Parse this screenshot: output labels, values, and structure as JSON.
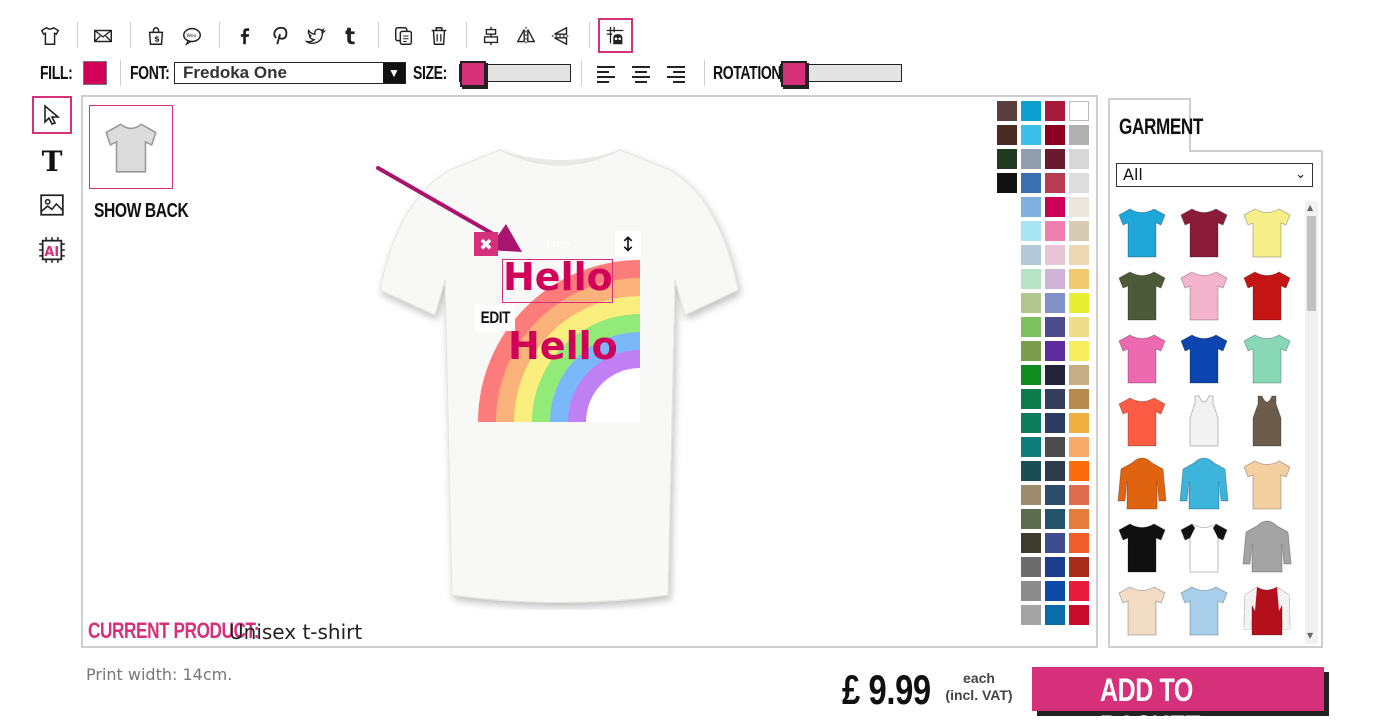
{
  "toolbar": {
    "fill_label": "FILL:",
    "fill_color": "#d10059",
    "font_label": "FONT:",
    "font_value": "Fredoka One",
    "size_label": "SIZE:",
    "rotation_label": "ROTATION:",
    "icons": [
      "tshirt-icon",
      "mail-icon",
      "shop-icon",
      "speech-icon",
      "facebook-icon",
      "pinterest-icon",
      "twitter-icon",
      "tumblr-icon",
      "copy-icon",
      "trash-icon",
      "align-center-vertical-icon",
      "flip-horizontal-icon",
      "flip-vertical-icon",
      "grid-snap-icon"
    ]
  },
  "left_tools": [
    "pointer-icon",
    "text-icon",
    "image-icon",
    "ai-icon"
  ],
  "canvas": {
    "show_back_label": "SHOW BACK",
    "text_top": "Hello",
    "text_bottom": "Hello",
    "measure_label": "14cm",
    "edit_label": "EDIT",
    "current_product_key": "CURRENT PRODUCT:",
    "current_product_value": "Unisex t-shirt",
    "print_width": "Print width: 14cm."
  },
  "palette": [
    [
      "#5a3e3e",
      "#0aa0d0",
      "#a81a3c",
      "#ffffff"
    ],
    [
      "#4b2c25",
      "#3cc0ea",
      "#8c0022",
      "#b0b0b0"
    ],
    [
      "#1f3a1f",
      "#8f9faf",
      "#6a1a2e",
      "#d8d8d8"
    ],
    [
      "#111111",
      "#3a6fb0",
      "#b83c50",
      "#dddddd"
    ],
    [
      null,
      "#7fb0e0",
      "#cc0055",
      "#ece6dc"
    ],
    [
      null,
      "#a8e4f4",
      "#ee80b0",
      "#d8cab0"
    ],
    [
      null,
      "#b4c8dc",
      "#e8c4d4",
      "#eed8b4"
    ],
    [
      null,
      "#b4e4c4",
      "#d0b4d8",
      "#f2c870"
    ],
    [
      null,
      "#b0c890",
      "#8090c8",
      "#e8ee30"
    ],
    [
      null,
      "#7cc060",
      "#4c4c8c",
      "#eede8c"
    ],
    [
      null,
      "#7c9c50",
      "#5c2c9c",
      "#f8ec5c"
    ],
    [
      null,
      "#108c20",
      "#23233a",
      "#c8ac84"
    ],
    [
      null,
      "#0c7c4c",
      "#363e5e",
      "#b8884c"
    ],
    [
      null,
      "#0c7c5c",
      "#2c3c60",
      "#f0b040"
    ],
    [
      null,
      "#0c7c7c",
      "#4c4c4c",
      "#f8ac6c"
    ],
    [
      null,
      "#1c4c54",
      "#2c3c4c",
      "#fc6c0c"
    ],
    [
      null,
      "#9c8c6c",
      "#2c4c6c",
      "#e06c50"
    ],
    [
      null,
      "#5c6c4c",
      "#24546c",
      "#e47c3c"
    ],
    [
      null,
      "#3c3c2c",
      "#3c4c8c",
      "#f05c2c"
    ],
    [
      null,
      "#6c6c6c",
      "#1c3c8c",
      "#a82c1c"
    ],
    [
      null,
      "#8c8c8c",
      "#0c4ca8",
      "#e81c3c"
    ],
    [
      null,
      "#a4a4a4",
      "#0c6ca8",
      "#c80c2c"
    ]
  ],
  "garment": {
    "tab_label": "GARMENT",
    "filter_value": "All",
    "items": [
      {
        "name": "tshirt",
        "color": "#1ea6d8"
      },
      {
        "name": "tshirt",
        "color": "#8a1c3a"
      },
      {
        "name": "tshirt",
        "color": "#f7f08a"
      },
      {
        "name": "tshirt",
        "color": "#4c5a38"
      },
      {
        "name": "tshirt",
        "color": "#f4b4cc"
      },
      {
        "name": "tshirt",
        "color": "#c41414"
      },
      {
        "name": "tshirt",
        "color": "#ee6ab0"
      },
      {
        "name": "tshirt",
        "color": "#0c44b0"
      },
      {
        "name": "tshirt",
        "color": "#88d8b8"
      },
      {
        "name": "tshirt",
        "color": "#fc5c44"
      },
      {
        "name": "vest",
        "color": "#f2f2f2"
      },
      {
        "name": "vest",
        "color": "#6c5c4c"
      },
      {
        "name": "hoodie",
        "color": "#e06410"
      },
      {
        "name": "hoodie",
        "color": "#3cb4dc"
      },
      {
        "name": "tshirt",
        "color": "#f4d0a0"
      },
      {
        "name": "tshirt",
        "color": "#101010"
      },
      {
        "name": "raglan",
        "color": "#ffffff"
      },
      {
        "name": "hoodie",
        "color": "#a4a4a4"
      },
      {
        "name": "tshirt",
        "color": "#f2dcc4"
      },
      {
        "name": "tshirt",
        "color": "#a8d0ec"
      },
      {
        "name": "jacket",
        "color": "#b4101c"
      }
    ]
  },
  "purchase": {
    "price": "£ 9.99",
    "each_line1": "each",
    "each_line2": "(incl. VAT)",
    "button_label": "ADD TO BASKET"
  }
}
